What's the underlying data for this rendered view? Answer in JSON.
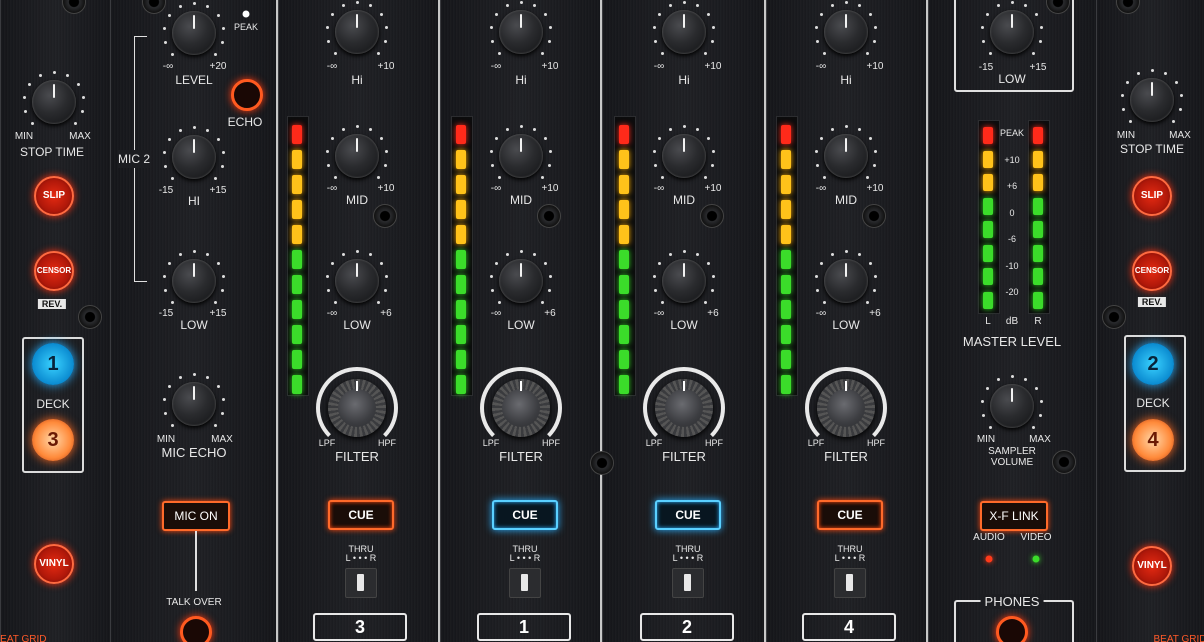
{
  "left_deck": {
    "stop_time": {
      "min": "MIN",
      "max": "MAX",
      "title": "STOP TIME"
    },
    "slip": "SLIP",
    "censor": "CENSOR",
    "rev": "REV.",
    "deck_label": "DECK",
    "deck_a": "1",
    "deck_b": "3",
    "vinyl": "VINYL",
    "beat_grid": "BEAT GRID"
  },
  "mic": {
    "level": {
      "min": "-∞",
      "max": "+20",
      "title": "LEVEL"
    },
    "peak": "PEAK",
    "echo": "ECHO",
    "mic2": "MIC 2",
    "hi": {
      "min": "-15",
      "max": "+15",
      "title": "HI"
    },
    "low": {
      "min": "-15",
      "max": "+15",
      "title": "LOW"
    },
    "mic_echo": {
      "min": "MIN",
      "max": "MAX",
      "title": "MIC ECHO"
    },
    "mic_on": "MIC ON",
    "talk_over": "TALK OVER"
  },
  "channels": [
    {
      "number": "3",
      "cue_active": false
    },
    {
      "number": "1",
      "cue_active": true
    },
    {
      "number": "2",
      "cue_active": true
    },
    {
      "number": "4",
      "cue_active": false
    }
  ],
  "channel_labels": {
    "hi": {
      "min": "-∞",
      "max": "+10",
      "title": "Hi"
    },
    "mid": {
      "min": "-∞",
      "max": "+10",
      "title": "MID"
    },
    "low": {
      "min": "-∞",
      "max": "+6",
      "title": "LOW"
    },
    "filter": {
      "lpf": "LPF",
      "hpf": "HPF",
      "title": "FILTER"
    },
    "cue": "CUE",
    "thru": "THRU",
    "thru_scale": "L • • • R"
  },
  "master": {
    "low": {
      "min": "-15",
      "max": "+15",
      "title": "LOW"
    },
    "scale": [
      "PEAK",
      "+10",
      "+6",
      "0",
      "-6",
      "-10",
      "-20"
    ],
    "l": "L",
    "db": "dB",
    "r": "R",
    "title": "MASTER LEVEL",
    "sampler": {
      "min": "MIN",
      "max": "MAX",
      "title_line1": "SAMPLER",
      "title_line2": "VOLUME"
    },
    "xf_link": "X-F LINK",
    "audio": "AUDIO",
    "video": "VIDEO",
    "phones": "PHONES"
  },
  "right_deck": {
    "stop_time": {
      "min": "MIN",
      "max": "MAX",
      "title": "STOP TIME"
    },
    "slip": "SLIP",
    "censor": "CENSOR",
    "rev": "REV.",
    "deck_label": "DECK",
    "deck_a": "2",
    "deck_b": "4",
    "vinyl": "VINYL",
    "beat_grid": "BEAT GRID"
  },
  "colors": {
    "led_red": "#ff2a1a",
    "led_yellow": "#ffc21a",
    "led_green": "#3bdc2a",
    "cue_orange": "#ff6a2a",
    "cue_blue": "#5ad0ff"
  }
}
